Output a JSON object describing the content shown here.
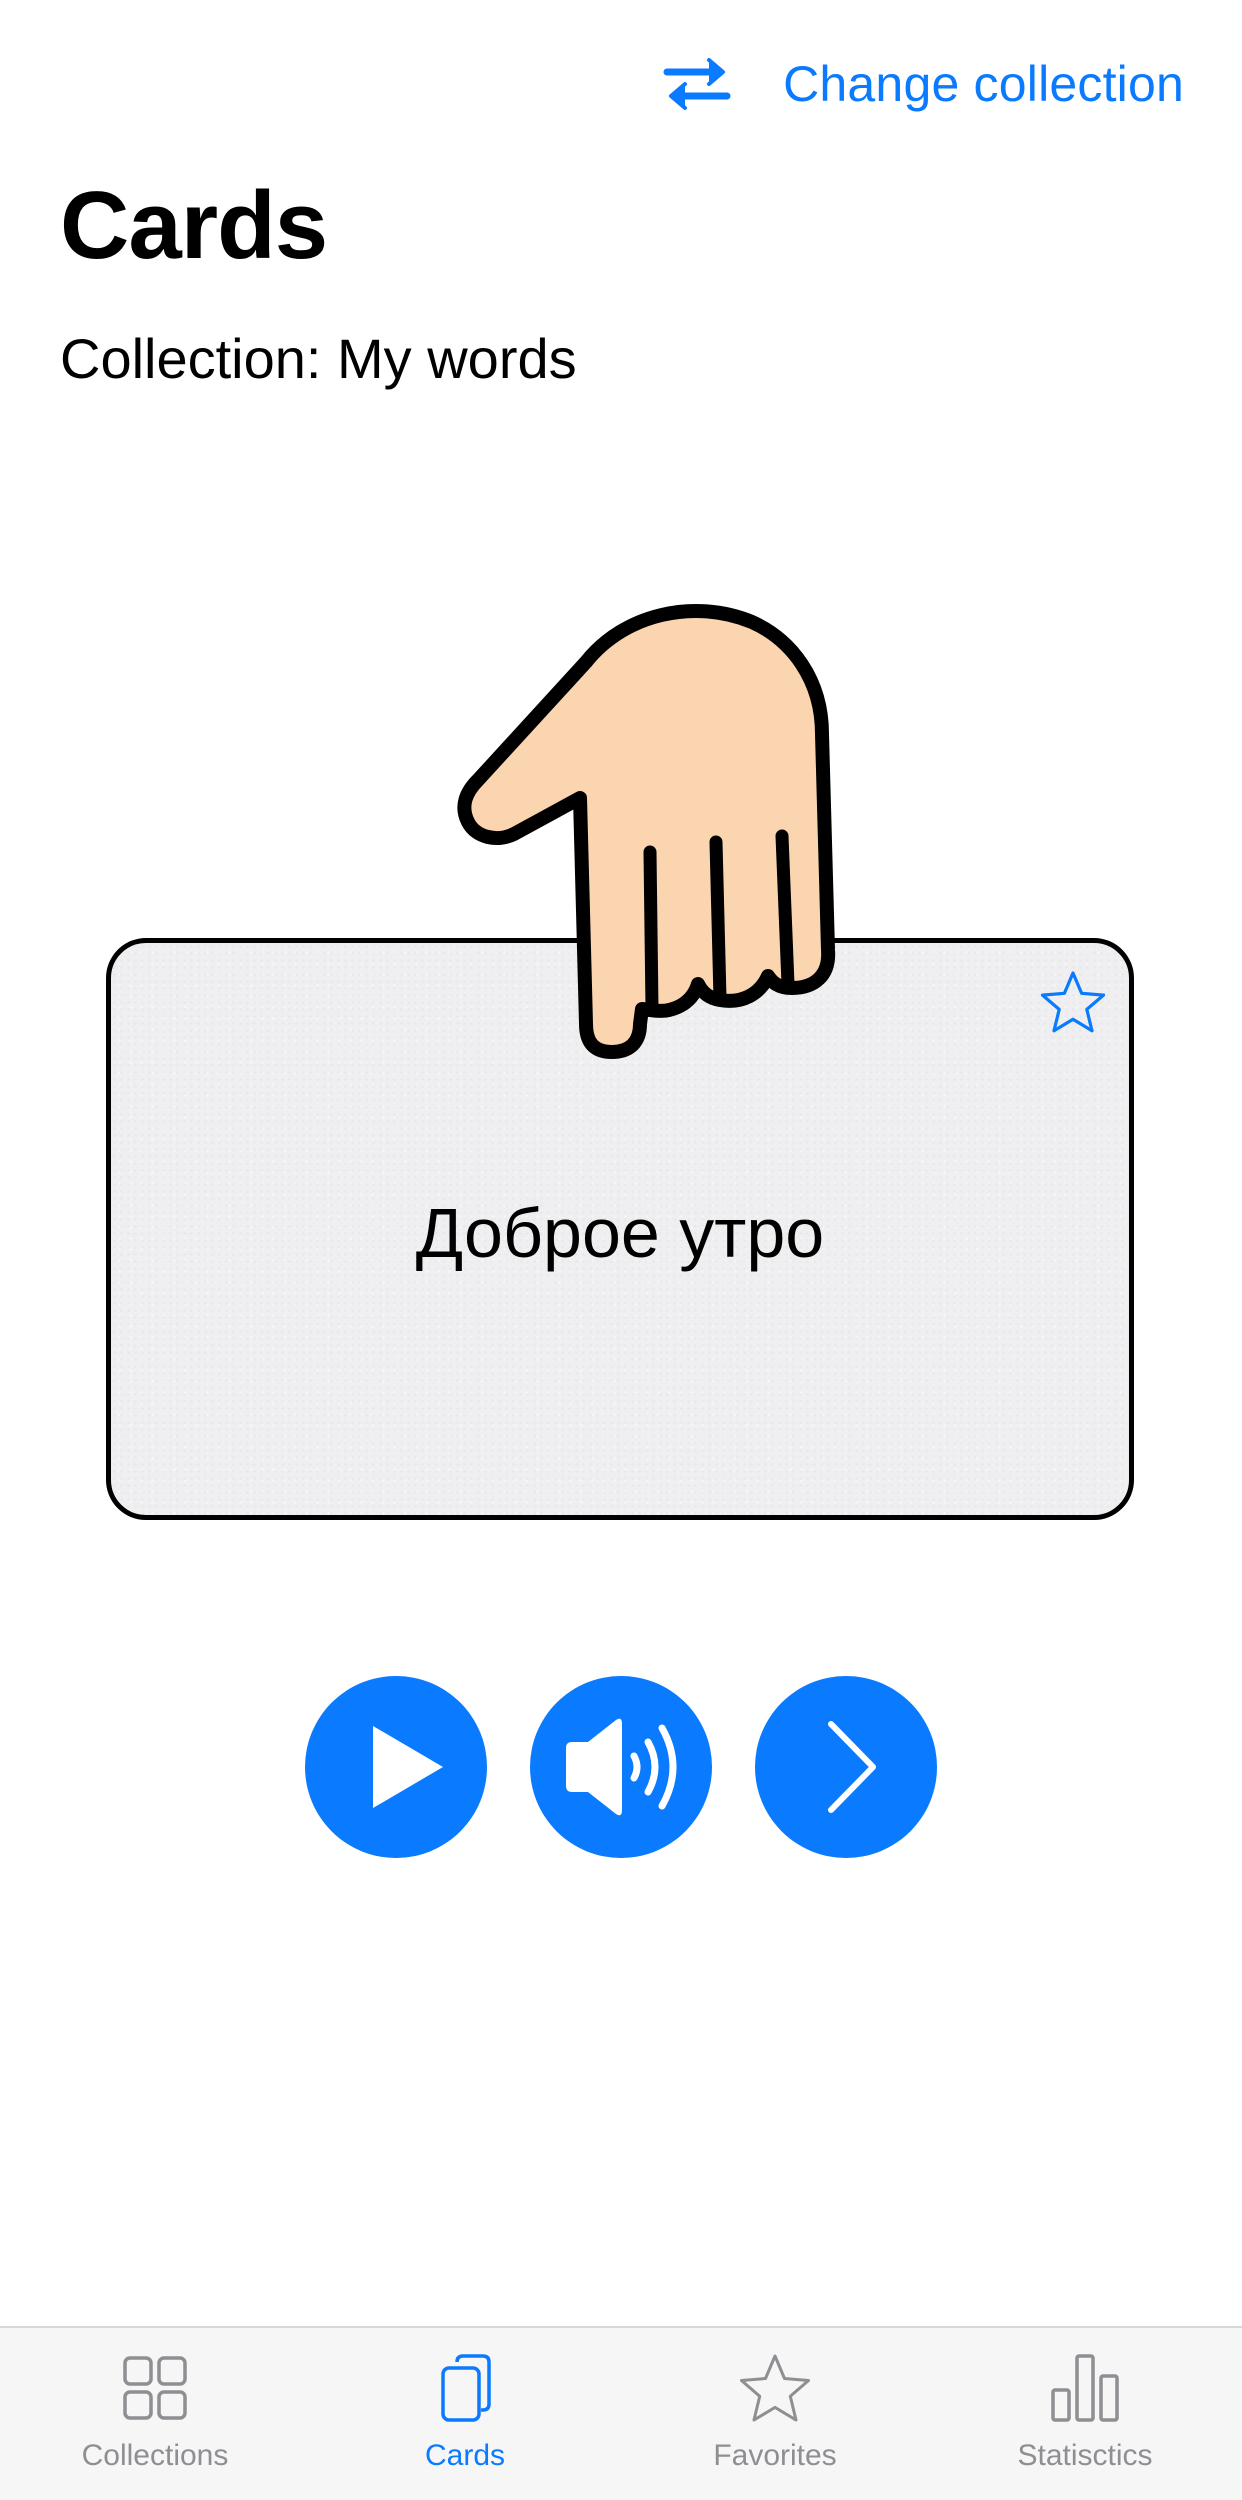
{
  "nav": {
    "action_label": "Change collection",
    "action_icon": "swap-arrows-icon"
  },
  "header": {
    "title": "Cards",
    "collection_prefix": "Collection:",
    "collection_name": "My words"
  },
  "card": {
    "word": "Доброе утро",
    "favorite": false,
    "favorite_icon": "star-outline-icon",
    "hint_icon": "pointing-hand-icon"
  },
  "controls": {
    "buttons": [
      {
        "name": "play",
        "icon": "play-icon"
      },
      {
        "name": "sound",
        "icon": "speaker-icon"
      },
      {
        "name": "next",
        "icon": "chevron-right-icon"
      }
    ]
  },
  "tabbar": {
    "tabs": [
      {
        "label": "Collections",
        "icon": "grid-icon",
        "active": false
      },
      {
        "label": "Cards",
        "icon": "cards-icon",
        "active": true
      },
      {
        "label": "Favorites",
        "icon": "star-icon",
        "active": false
      },
      {
        "label": "Statisctics",
        "icon": "bar-chart-icon",
        "active": false
      }
    ]
  },
  "colors": {
    "accent": "#0A7AFF",
    "inactive": "#8E8E93",
    "card_background": "#EFEFF1",
    "hand_skin": "#FAD5B0",
    "tabbar_background": "#F6F6F6"
  }
}
